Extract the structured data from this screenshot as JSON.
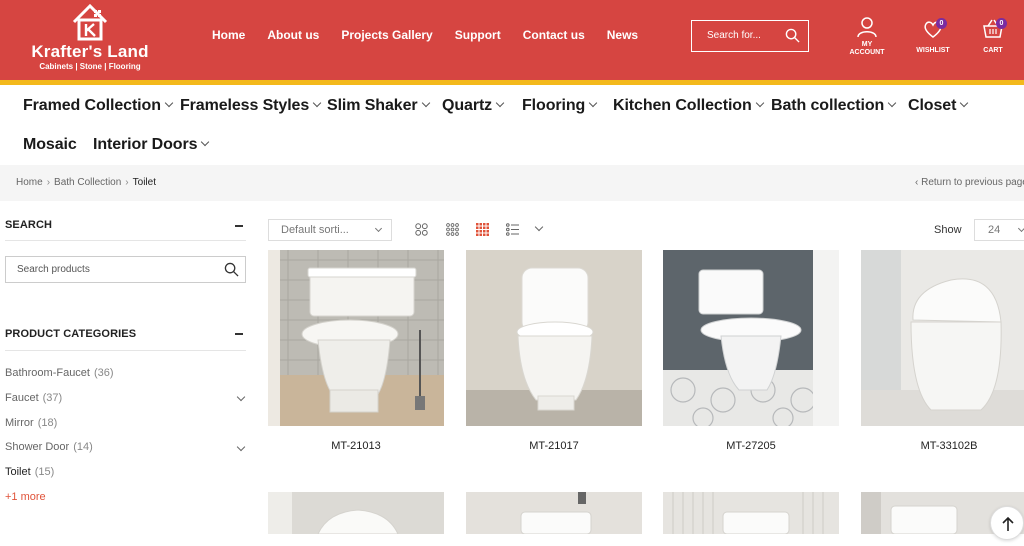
{
  "brand": {
    "name": "Krafter's Land",
    "tagline": "Cabinets | Stone | Flooring"
  },
  "topnav": [
    {
      "label": "Home"
    },
    {
      "label": "About us"
    },
    {
      "label": "Projects Gallery"
    },
    {
      "label": "Support"
    },
    {
      "label": "Contact us"
    },
    {
      "label": "News"
    }
  ],
  "search": {
    "placeholder": "Search for..."
  },
  "header_icons": {
    "account": {
      "line1": "MY",
      "line2": "ACCOUNT"
    },
    "wishlist": {
      "label": "WISHLIST",
      "count": "0"
    },
    "cart": {
      "label": "CART",
      "count": "0"
    }
  },
  "categories": [
    {
      "label": "Framed Collection",
      "dropdown": true
    },
    {
      "label": "Frameless Styles",
      "dropdown": true
    },
    {
      "label": "Slim Shaker",
      "dropdown": true
    },
    {
      "label": "Quartz",
      "dropdown": true
    },
    {
      "label": "Flooring",
      "dropdown": true
    },
    {
      "label": "Kitchen Collection",
      "dropdown": true
    },
    {
      "label": "Bath collection",
      "dropdown": true
    },
    {
      "label": "Closet",
      "dropdown": true
    },
    {
      "label": "Mosaic",
      "dropdown": false
    },
    {
      "label": "Interior Doors",
      "dropdown": true
    }
  ],
  "breadcrumb": {
    "items": [
      "Home",
      "Bath Collection",
      "Toilet"
    ],
    "return_label": "Return to previous page"
  },
  "sidebar": {
    "search_title": "SEARCH",
    "search_placeholder": "Search products",
    "categories_title": "PRODUCT CATEGORIES",
    "items": [
      {
        "label": "Bathroom-Faucet",
        "count": "(36)",
        "expandable": false
      },
      {
        "label": "Faucet",
        "count": "(37)",
        "expandable": true
      },
      {
        "label": "Mirror",
        "count": "(18)",
        "expandable": false
      },
      {
        "label": "Shower Door",
        "count": "(14)",
        "expandable": true
      },
      {
        "label": "Toilet",
        "count": "(15)",
        "expandable": false,
        "active": true
      }
    ],
    "more_label": "+1 more"
  },
  "toolbar": {
    "sort_label": "Default sorti...",
    "show_label": "Show",
    "show_value": "24",
    "active_view": "grid-4"
  },
  "products": [
    {
      "name": "MT-21013"
    },
    {
      "name": "MT-21017"
    },
    {
      "name": "MT-27205"
    },
    {
      "name": "MT-33102B"
    }
  ],
  "colors": {
    "header_bg": "#d64541",
    "accent_stripe": "#f3b91c",
    "badge": "#7b2ca0",
    "link_accent": "#e0533a"
  }
}
